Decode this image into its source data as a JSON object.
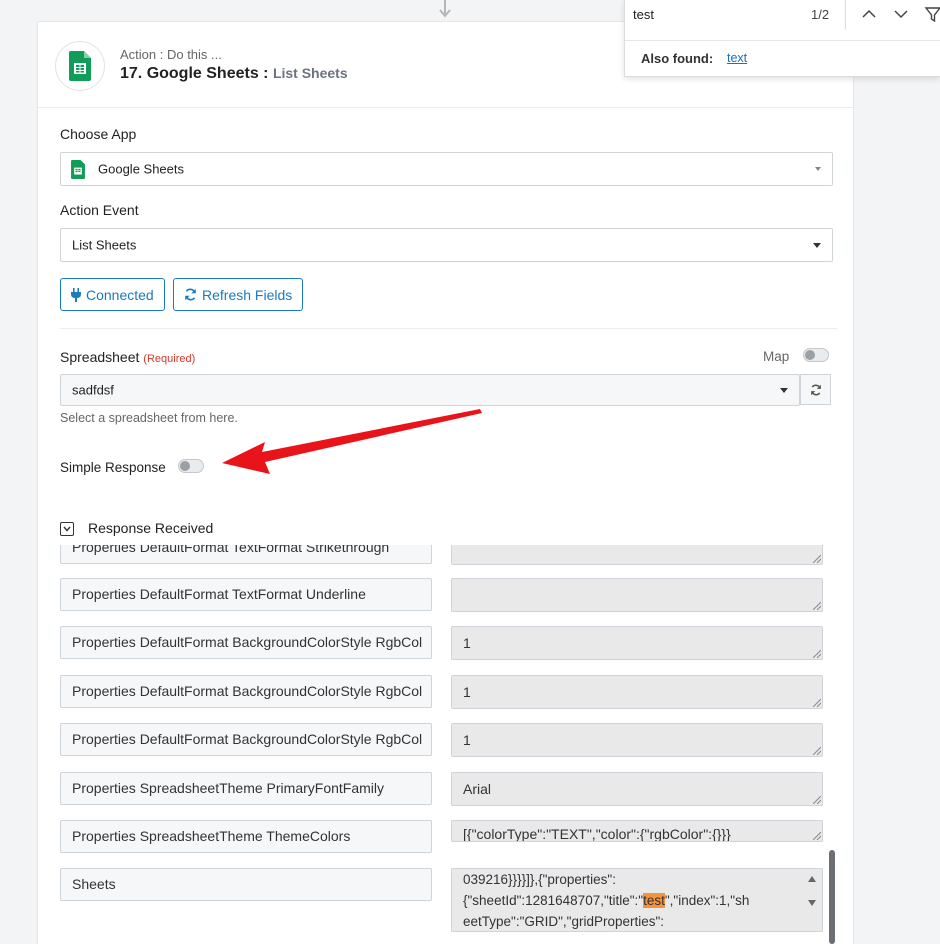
{
  "step": {
    "kicker": "Action : Do this ...",
    "title": "17. Google Sheets : ",
    "subtitle": "List Sheets"
  },
  "choose_app": {
    "label": "Choose App",
    "value": "Google Sheets"
  },
  "action_event": {
    "label": "Action Event",
    "value": "List Sheets"
  },
  "buttons": {
    "connected": "Connected",
    "refresh_fields": "Refresh Fields"
  },
  "spreadsheet": {
    "label": "Spreadsheet",
    "required": "(Required)",
    "map_label": "Map",
    "value": "sadfdsf",
    "help": "Select a spreadsheet from here."
  },
  "simple_response": {
    "label": "Simple Response",
    "enabled": false
  },
  "response_received": {
    "label": "Response Received",
    "checked": true
  },
  "rows": [
    {
      "label": "Properties DefaultFormat TextFormat Strikethrough",
      "value": ""
    },
    {
      "label": "Properties DefaultFormat TextFormat Underline",
      "value": ""
    },
    {
      "label": "Properties DefaultFormat BackgroundColorStyle RgbCol",
      "value": "1"
    },
    {
      "label": "Properties DefaultFormat BackgroundColorStyle RgbCol",
      "value": "1"
    },
    {
      "label": "Properties DefaultFormat BackgroundColorStyle RgbCol",
      "value": "1"
    },
    {
      "label": "Properties SpreadsheetTheme PrimaryFontFamily",
      "value": "Arial"
    },
    {
      "label": "Properties SpreadsheetTheme ThemeColors",
      "value": "[{\"colorType\":\"TEXT\",\"color\":{\"rgbColor\":{}}}"
    },
    {
      "label": "Sheets",
      "value": ""
    }
  ],
  "sheets_value": {
    "line1": "039216}}}}]},{\"properties\":",
    "line2_a": "{\"sheetId\":1281648707,\"title\":\"",
    "line2_hl": "test",
    "line2_b": "\",\"index\":1,\"sh",
    "line3": "eetType\":\"GRID\",\"gridProperties\":"
  },
  "find_bar": {
    "query": "test",
    "count": "1/2",
    "also_found_label": "Also found:",
    "also_found_link": "text"
  },
  "colors": {
    "accent": "#1a7bbf",
    "required": "#d9372b",
    "annotation_arrow": "#e8141a",
    "highlight": "#f4933b",
    "sheets_green": "#0f9d58"
  }
}
